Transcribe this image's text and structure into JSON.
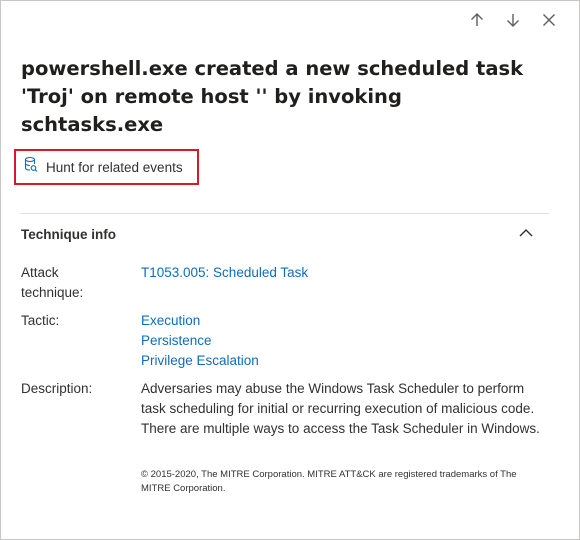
{
  "nav": {
    "up_icon": "arrow-up-icon",
    "down_icon": "arrow-down-icon",
    "close_icon": "close-icon"
  },
  "title": "powershell.exe created a new scheduled task 'Troj' on remote host '' by invoking schtasks.exe",
  "hunt": {
    "label": "Hunt for related events",
    "icon": "database-search-icon",
    "highlight_color": "#d8182b"
  },
  "technique_info": {
    "header": "Technique info",
    "collapse_icon": "chevron-up-icon",
    "attack_technique_label": "Attack technique:",
    "attack_technique_value": "T1053.005: Scheduled Task",
    "tactic_label": "Tactic:",
    "tactics": [
      "Execution",
      "Persistence",
      "Privilege Escalation"
    ],
    "description_label": "Description:",
    "description": "Adversaries may abuse the Windows Task Scheduler to perform task scheduling for initial or recurring execution of malicious code. There are multiple ways to access the Task Scheduler in Windows.",
    "copyright": "© 2015-2020, The MITRE Corporation. MITRE ATT&CK are registered trademarks of The MITRE Corporation."
  },
  "colors": {
    "link": "#0f6cbd",
    "text": "#323130"
  }
}
